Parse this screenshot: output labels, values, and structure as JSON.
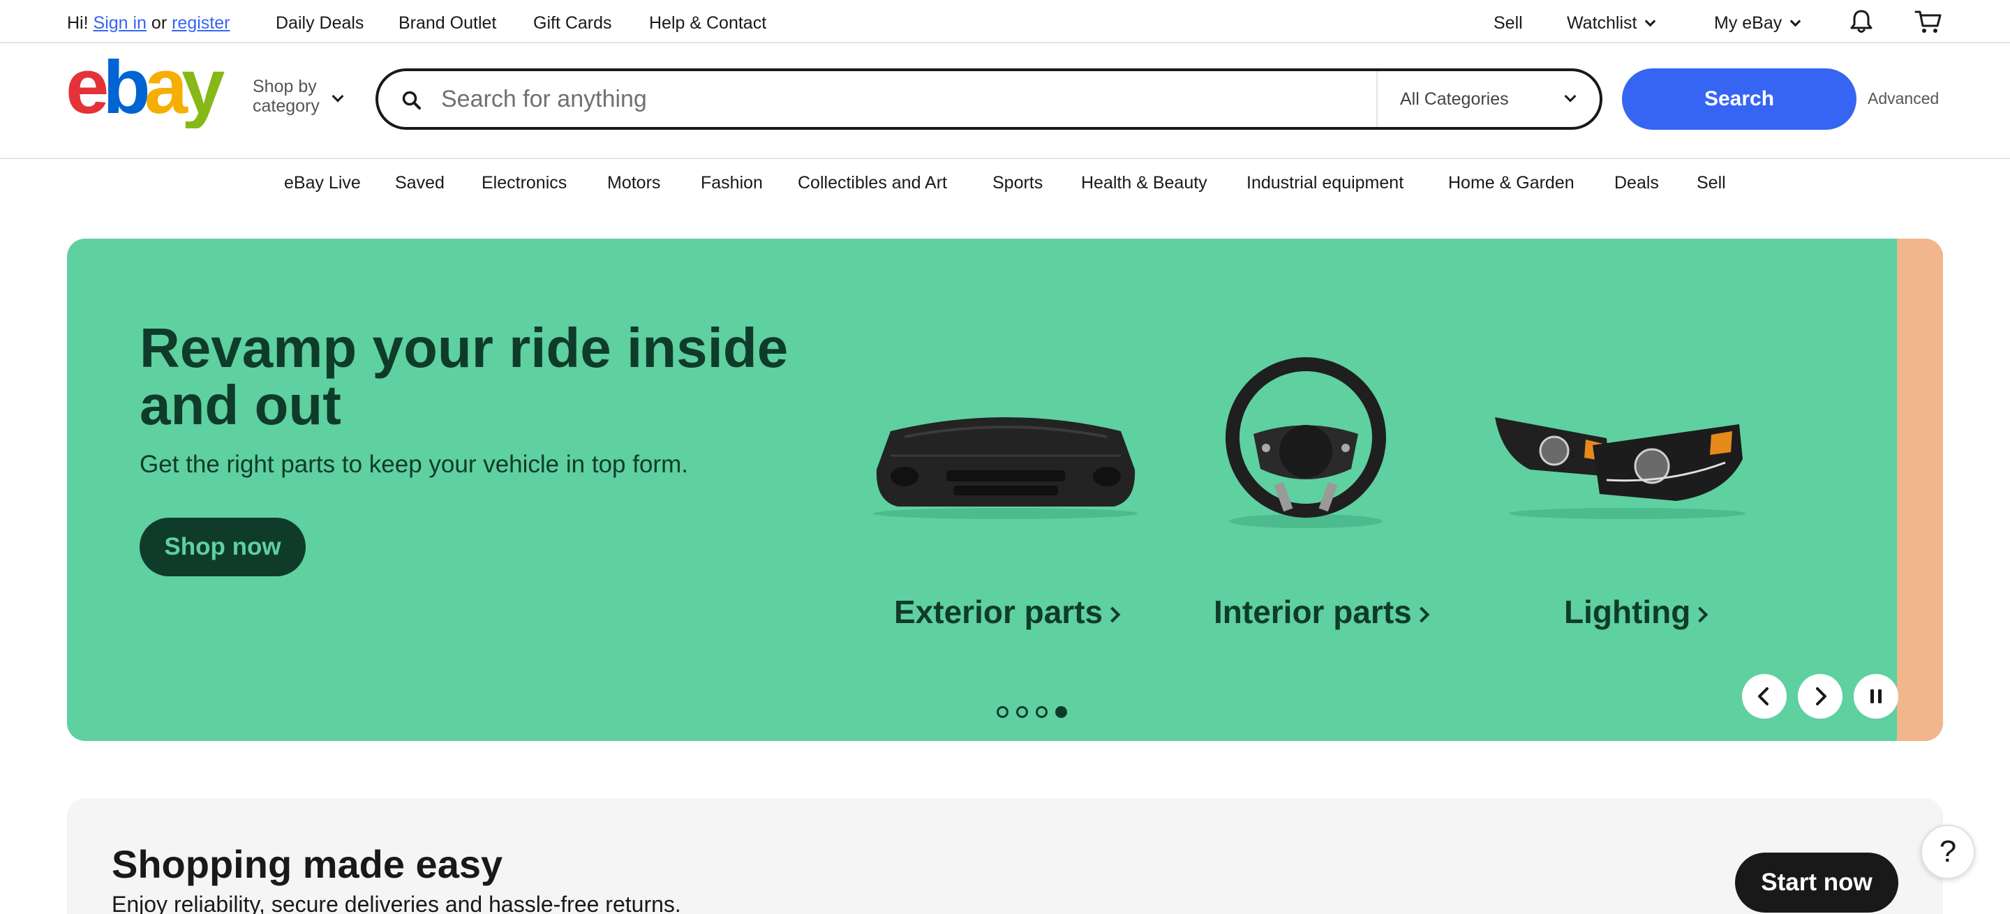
{
  "topbar": {
    "greeting_prefix": "Hi!",
    "sign_in": "Sign in",
    "or": "or",
    "register": "register",
    "links": [
      "Daily Deals",
      "Brand Outlet",
      "Gift Cards",
      "Help & Contact"
    ],
    "sell": "Sell",
    "watchlist": "Watchlist",
    "my_ebay": "My eBay"
  },
  "header": {
    "shop_by_line1": "Shop by",
    "shop_by_line2": "category",
    "search_placeholder": "Search for anything",
    "category_select": "All Categories",
    "search_button": "Search",
    "advanced": "Advanced"
  },
  "nav": {
    "items": [
      "eBay Live",
      "Saved",
      "Electronics",
      "Motors",
      "Fashion",
      "Collectibles and Art",
      "Sports",
      "Health & Beauty",
      "Industrial equipment",
      "Home & Garden",
      "Deals",
      "Sell"
    ]
  },
  "hero": {
    "title": "Revamp your ride inside and out",
    "subtitle": "Get the right parts to keep your vehicle in top form.",
    "cta": "Shop now",
    "parts": [
      "Exterior parts",
      "Interior parts",
      "Lighting"
    ],
    "slide_count": 4,
    "active_slide": 4,
    "colors": {
      "background": "#5fd0a0",
      "text": "#0f3b2a",
      "next_slide": "#f2b68c"
    }
  },
  "easy": {
    "title": "Shopping made easy",
    "subtitle": "Enjoy reliability, secure deliveries and hassle-free returns.",
    "cta": "Start now"
  },
  "help": {
    "label": "?"
  },
  "icons": [
    "search-icon",
    "bell-icon",
    "cart-icon",
    "chevron-down-icon",
    "chevron-left-icon",
    "chevron-right-icon",
    "pause-icon",
    "help-icon"
  ],
  "colors": {
    "accent": "#3665f3",
    "text": "#191919"
  }
}
